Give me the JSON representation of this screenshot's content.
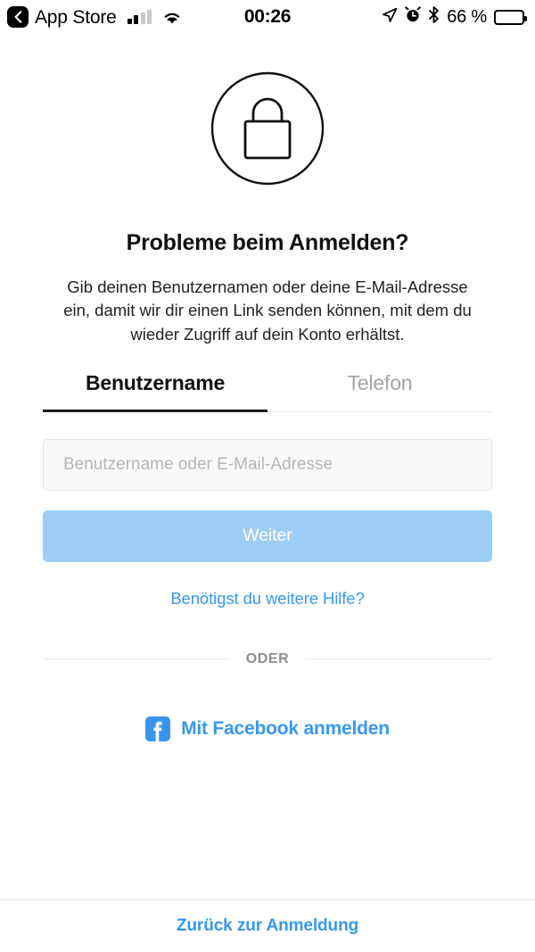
{
  "status_bar": {
    "back_label": "App Store",
    "back_icon": "chevron-left-icon",
    "signal_icon": "cellular-signal-icon",
    "signal_bars_filled": 2,
    "signal_bars_total": 4,
    "wifi_icon": "wifi-icon",
    "time": "00:26",
    "location_icon": "location-arrow-icon",
    "alarm_icon": "alarm-clock-icon",
    "bluetooth_icon": "bluetooth-icon",
    "battery_percent_label": "66 %",
    "battery_level": 66,
    "battery_icon": "battery-icon"
  },
  "main": {
    "lock_icon": "lock-circle-icon",
    "title": "Probleme beim Anmelden?",
    "description": "Gib deinen Benutzernamen oder deine E-Mail-Adresse ein, damit wir dir einen Link senden können, mit dem du wieder Zugriff auf dein Konto erhältst.",
    "tabs": [
      {
        "label": "Benutzername",
        "active": true
      },
      {
        "label": "Telefon",
        "active": false
      }
    ],
    "input": {
      "placeholder": "Benutzername oder E-Mail-Adresse",
      "value": ""
    },
    "submit_label": "Weiter",
    "help_link_label": "Benötigst du weitere Hilfe?",
    "divider_label": "ODER",
    "facebook": {
      "icon": "facebook-icon",
      "label": "Mit Facebook anmelden"
    }
  },
  "bottom_bar": {
    "back_to_login_label": "Zurück zur Anmeldung"
  },
  "colors": {
    "accent_blue": "#3897f0",
    "button_disabled_blue": "#9ccdf7",
    "facebook_blue": "#3b94ec",
    "muted_gray": "#8e8e8e",
    "placeholder_gray": "#b6b6b9"
  }
}
